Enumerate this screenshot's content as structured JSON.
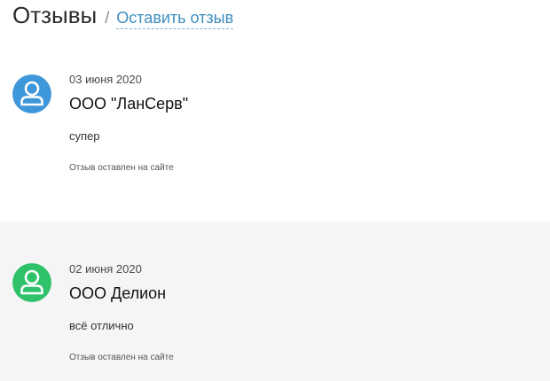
{
  "header": {
    "title": "Отзывы",
    "separator": "/",
    "leave_review_link": "Оставить отзыв"
  },
  "reviews": [
    {
      "date": "03 июня 2020",
      "author": "ООО \"ЛанСерв\"",
      "text": "супер",
      "source": "Отзыв оставлен на сайте",
      "avatar_icon": "user-icon",
      "avatar_color": "#3e97d9"
    },
    {
      "date": "02 июня 2020",
      "author": "ООО Делион",
      "text": "всё отлично",
      "source": "Отзыв оставлен на сайте",
      "avatar_icon": "user-icon",
      "avatar_color": "#2fc26a"
    }
  ],
  "colors": {
    "link": "#3d8fc0",
    "alt_row_background": "#f5f5f5"
  }
}
